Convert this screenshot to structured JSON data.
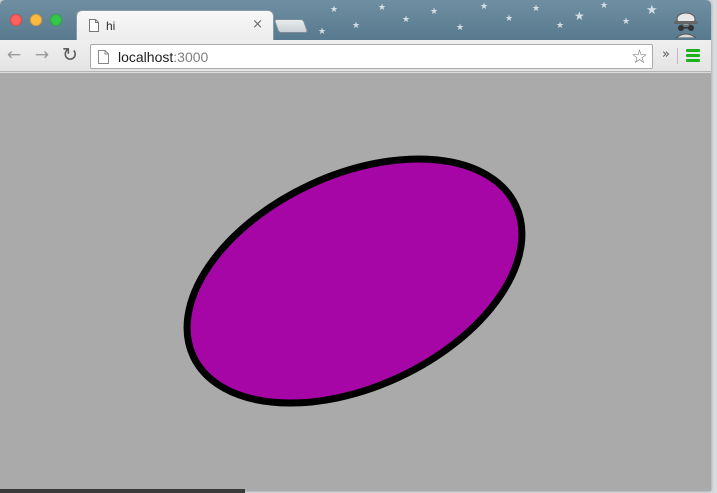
{
  "browser": {
    "tab": {
      "title": "hi",
      "close_symbol": "×"
    },
    "address_bar": {
      "host": "localhost",
      "port": ":3000"
    },
    "icons": {
      "back": "back-arrow-icon",
      "forward": "forward-arrow-icon",
      "reload": "reload-icon",
      "bookmark": "star-icon",
      "extensions": "chevron-double-right-icon",
      "menu": "hamburger-menu-icon",
      "profile": "incognito-icon"
    },
    "glyphs": {
      "back": "←",
      "forward": "→",
      "reload": "↻",
      "bookmark": "☆",
      "extensions": "»"
    }
  },
  "page": {
    "background": "#aaaaaa",
    "ellipse": {
      "fill": "#a506a5",
      "stroke": "#000000"
    }
  }
}
